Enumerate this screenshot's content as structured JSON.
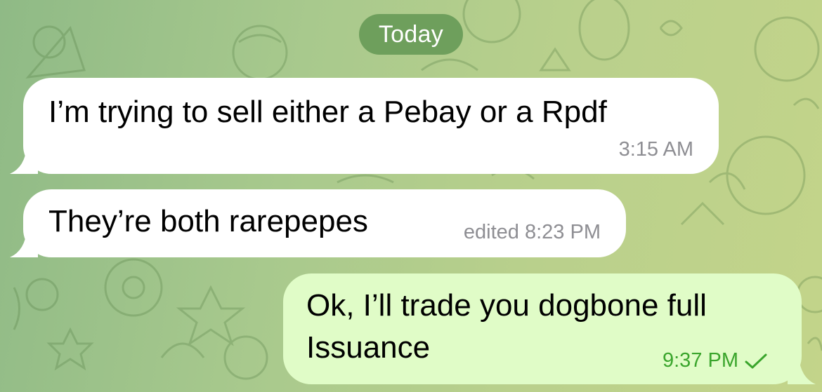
{
  "chat": {
    "date_label": "Today",
    "messages": [
      {
        "direction": "incoming",
        "text": "I’m trying to sell either a Pebay or a Rpdf",
        "meta": "3:15 AM"
      },
      {
        "direction": "incoming",
        "text": "They’re both rarepepes",
        "meta": "edited 8:23 PM"
      },
      {
        "direction": "outgoing",
        "text": "Ok, I’ll trade you dogbone full Issuance",
        "meta": "9:37 PM",
        "status": "sent-check"
      }
    ]
  },
  "colors": {
    "incoming_bubble": "#ffffff",
    "outgoing_bubble": "#e0fcc7",
    "date_pill": "#6e9f5c",
    "outgoing_time": "#3aa52c",
    "incoming_time": "#8e8e93"
  }
}
